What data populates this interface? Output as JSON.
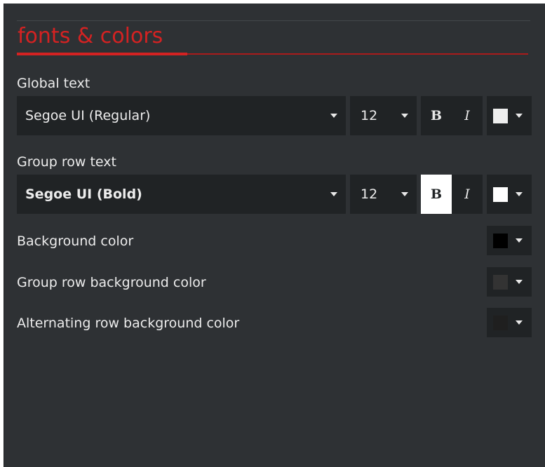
{
  "section": {
    "title": "fonts & colors"
  },
  "global_text": {
    "label": "Global text",
    "font": "Segoe UI (Regular)",
    "size": "12",
    "bold_label": "B",
    "italic_label": "I",
    "bold_active": false,
    "color": "#eeeeee"
  },
  "group_row_text": {
    "label": "Group row text",
    "font": "Segoe UI (Bold)",
    "size": "12",
    "bold_label": "B",
    "italic_label": "I",
    "bold_active": true,
    "color": "#ffffff"
  },
  "background_color": {
    "label": "Background color",
    "color": "#000000"
  },
  "group_row_background_color": {
    "label": "Group row background color",
    "color": "#333333"
  },
  "alternating_row_background_color": {
    "label": "Alternating row background color",
    "color": "#1f1f1f"
  },
  "theme": {
    "accent": "#d42222",
    "panel_bg": "#2e3134",
    "control_bg": "#202325",
    "text": "#ececec"
  }
}
